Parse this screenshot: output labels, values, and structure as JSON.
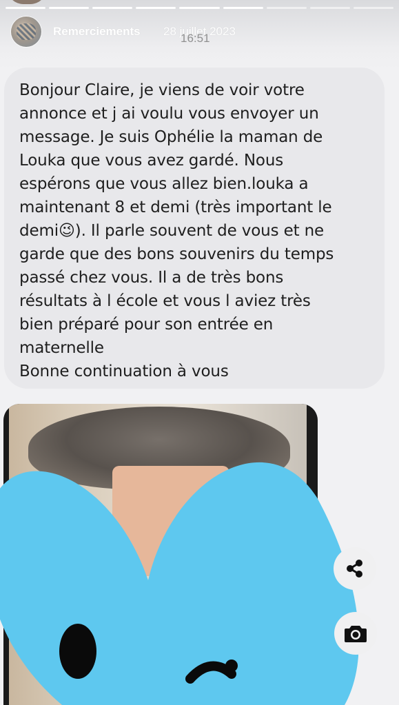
{
  "story": {
    "username": "Remerciements",
    "date": "28 juillet 2023",
    "progress_segments": 9,
    "progress_current": 6
  },
  "status_bar": {
    "time": "16:51"
  },
  "message": {
    "text": "Bonjour Claire, je viens de voir votre\nannonce et j ai voulu vous envoyer un\nmessage. Je suis Ophélie la maman de\nLouka que vous avez gardé. Nous\nespérons que vous allez bien.louka a\nmaintenant 8 et demi (très important le\ndemi😉). Il parle souvent de vous et ne\ngarde que des bons souvenirs du temps\npassé chez vous. Il a de très bons\nrésultats à l école et vous l aviez très\nbien préparé pour son entrée en\nmaternelle\n Bonne continuation à vous"
  },
  "icons": {
    "share": "share-icon",
    "camera": "camera-icon"
  },
  "colors": {
    "bubble": "#e8e8eb",
    "sticker": "#5ec8ef",
    "background": "#f1f1f3"
  }
}
